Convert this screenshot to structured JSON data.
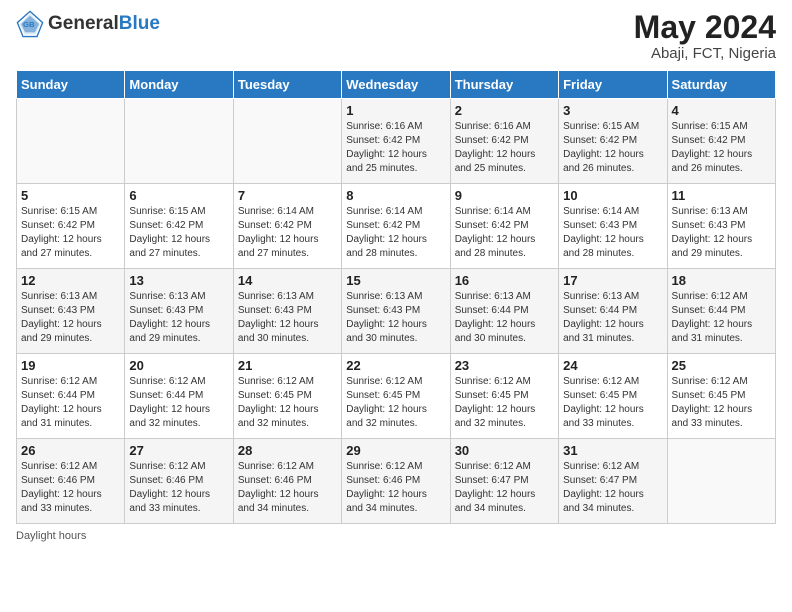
{
  "header": {
    "logo_general": "General",
    "logo_blue": "Blue",
    "month_year": "May 2024",
    "location": "Abaji, FCT, Nigeria"
  },
  "days_of_week": [
    "Sunday",
    "Monday",
    "Tuesday",
    "Wednesday",
    "Thursday",
    "Friday",
    "Saturday"
  ],
  "weeks": [
    [
      {
        "day": "",
        "sunrise": "",
        "sunset": "",
        "daylight": ""
      },
      {
        "day": "",
        "sunrise": "",
        "sunset": "",
        "daylight": ""
      },
      {
        "day": "",
        "sunrise": "",
        "sunset": "",
        "daylight": ""
      },
      {
        "day": "1",
        "sunrise": "Sunrise: 6:16 AM",
        "sunset": "Sunset: 6:42 PM",
        "daylight": "Daylight: 12 hours and 25 minutes."
      },
      {
        "day": "2",
        "sunrise": "Sunrise: 6:16 AM",
        "sunset": "Sunset: 6:42 PM",
        "daylight": "Daylight: 12 hours and 25 minutes."
      },
      {
        "day": "3",
        "sunrise": "Sunrise: 6:15 AM",
        "sunset": "Sunset: 6:42 PM",
        "daylight": "Daylight: 12 hours and 26 minutes."
      },
      {
        "day": "4",
        "sunrise": "Sunrise: 6:15 AM",
        "sunset": "Sunset: 6:42 PM",
        "daylight": "Daylight: 12 hours and 26 minutes."
      }
    ],
    [
      {
        "day": "5",
        "sunrise": "Sunrise: 6:15 AM",
        "sunset": "Sunset: 6:42 PM",
        "daylight": "Daylight: 12 hours and 27 minutes."
      },
      {
        "day": "6",
        "sunrise": "Sunrise: 6:15 AM",
        "sunset": "Sunset: 6:42 PM",
        "daylight": "Daylight: 12 hours and 27 minutes."
      },
      {
        "day": "7",
        "sunrise": "Sunrise: 6:14 AM",
        "sunset": "Sunset: 6:42 PM",
        "daylight": "Daylight: 12 hours and 27 minutes."
      },
      {
        "day": "8",
        "sunrise": "Sunrise: 6:14 AM",
        "sunset": "Sunset: 6:42 PM",
        "daylight": "Daylight: 12 hours and 28 minutes."
      },
      {
        "day": "9",
        "sunrise": "Sunrise: 6:14 AM",
        "sunset": "Sunset: 6:42 PM",
        "daylight": "Daylight: 12 hours and 28 minutes."
      },
      {
        "day": "10",
        "sunrise": "Sunrise: 6:14 AM",
        "sunset": "Sunset: 6:43 PM",
        "daylight": "Daylight: 12 hours and 28 minutes."
      },
      {
        "day": "11",
        "sunrise": "Sunrise: 6:13 AM",
        "sunset": "Sunset: 6:43 PM",
        "daylight": "Daylight: 12 hours and 29 minutes."
      }
    ],
    [
      {
        "day": "12",
        "sunrise": "Sunrise: 6:13 AM",
        "sunset": "Sunset: 6:43 PM",
        "daylight": "Daylight: 12 hours and 29 minutes."
      },
      {
        "day": "13",
        "sunrise": "Sunrise: 6:13 AM",
        "sunset": "Sunset: 6:43 PM",
        "daylight": "Daylight: 12 hours and 29 minutes."
      },
      {
        "day": "14",
        "sunrise": "Sunrise: 6:13 AM",
        "sunset": "Sunset: 6:43 PM",
        "daylight": "Daylight: 12 hours and 30 minutes."
      },
      {
        "day": "15",
        "sunrise": "Sunrise: 6:13 AM",
        "sunset": "Sunset: 6:43 PM",
        "daylight": "Daylight: 12 hours and 30 minutes."
      },
      {
        "day": "16",
        "sunrise": "Sunrise: 6:13 AM",
        "sunset": "Sunset: 6:44 PM",
        "daylight": "Daylight: 12 hours and 30 minutes."
      },
      {
        "day": "17",
        "sunrise": "Sunrise: 6:13 AM",
        "sunset": "Sunset: 6:44 PM",
        "daylight": "Daylight: 12 hours and 31 minutes."
      },
      {
        "day": "18",
        "sunrise": "Sunrise: 6:12 AM",
        "sunset": "Sunset: 6:44 PM",
        "daylight": "Daylight: 12 hours and 31 minutes."
      }
    ],
    [
      {
        "day": "19",
        "sunrise": "Sunrise: 6:12 AM",
        "sunset": "Sunset: 6:44 PM",
        "daylight": "Daylight: 12 hours and 31 minutes."
      },
      {
        "day": "20",
        "sunrise": "Sunrise: 6:12 AM",
        "sunset": "Sunset: 6:44 PM",
        "daylight": "Daylight: 12 hours and 32 minutes."
      },
      {
        "day": "21",
        "sunrise": "Sunrise: 6:12 AM",
        "sunset": "Sunset: 6:45 PM",
        "daylight": "Daylight: 12 hours and 32 minutes."
      },
      {
        "day": "22",
        "sunrise": "Sunrise: 6:12 AM",
        "sunset": "Sunset: 6:45 PM",
        "daylight": "Daylight: 12 hours and 32 minutes."
      },
      {
        "day": "23",
        "sunrise": "Sunrise: 6:12 AM",
        "sunset": "Sunset: 6:45 PM",
        "daylight": "Daylight: 12 hours and 32 minutes."
      },
      {
        "day": "24",
        "sunrise": "Sunrise: 6:12 AM",
        "sunset": "Sunset: 6:45 PM",
        "daylight": "Daylight: 12 hours and 33 minutes."
      },
      {
        "day": "25",
        "sunrise": "Sunrise: 6:12 AM",
        "sunset": "Sunset: 6:45 PM",
        "daylight": "Daylight: 12 hours and 33 minutes."
      }
    ],
    [
      {
        "day": "26",
        "sunrise": "Sunrise: 6:12 AM",
        "sunset": "Sunset: 6:46 PM",
        "daylight": "Daylight: 12 hours and 33 minutes."
      },
      {
        "day": "27",
        "sunrise": "Sunrise: 6:12 AM",
        "sunset": "Sunset: 6:46 PM",
        "daylight": "Daylight: 12 hours and 33 minutes."
      },
      {
        "day": "28",
        "sunrise": "Sunrise: 6:12 AM",
        "sunset": "Sunset: 6:46 PM",
        "daylight": "Daylight: 12 hours and 34 minutes."
      },
      {
        "day": "29",
        "sunrise": "Sunrise: 6:12 AM",
        "sunset": "Sunset: 6:46 PM",
        "daylight": "Daylight: 12 hours and 34 minutes."
      },
      {
        "day": "30",
        "sunrise": "Sunrise: 6:12 AM",
        "sunset": "Sunset: 6:47 PM",
        "daylight": "Daylight: 12 hours and 34 minutes."
      },
      {
        "day": "31",
        "sunrise": "Sunrise: 6:12 AM",
        "sunset": "Sunset: 6:47 PM",
        "daylight": "Daylight: 12 hours and 34 minutes."
      },
      {
        "day": "",
        "sunrise": "",
        "sunset": "",
        "daylight": ""
      }
    ]
  ],
  "footer": {
    "daylight_hours_label": "Daylight hours"
  }
}
